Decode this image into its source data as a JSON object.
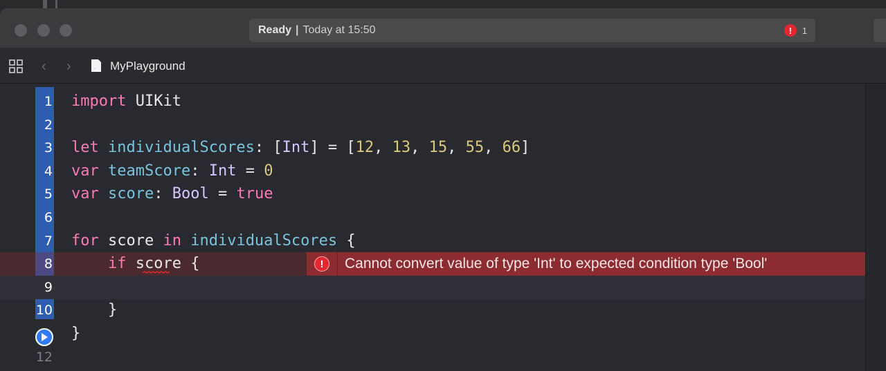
{
  "window": {
    "status_ready": "Ready",
    "status_separator": "|",
    "status_time": "Today at 15:50",
    "error_count": "1",
    "error_badge_glyph": "!"
  },
  "jumpbar": {
    "icons": [
      "grid-icon",
      "back-arrow-icon",
      "forward-arrow-icon",
      "swift-file-icon"
    ],
    "back_glyph": "‹",
    "forward_glyph": "›",
    "file_name": "MyPlayground"
  },
  "editor": {
    "lines": [
      {
        "number": "1",
        "tokens": [
          [
            "kw",
            "import"
          ],
          [
            "plain",
            " UIKit"
          ]
        ]
      },
      {
        "number": "2",
        "tokens": []
      },
      {
        "number": "3",
        "tokens": [
          [
            "kw",
            "let"
          ],
          [
            "plain",
            " "
          ],
          [
            "id",
            "individualScores"
          ],
          [
            "plain",
            ": ["
          ],
          [
            "ty",
            "Int"
          ],
          [
            "plain",
            "] = ["
          ],
          [
            "num",
            "12"
          ],
          [
            "plain",
            ", "
          ],
          [
            "num",
            "13"
          ],
          [
            "plain",
            ", "
          ],
          [
            "num",
            "15"
          ],
          [
            "plain",
            ", "
          ],
          [
            "num",
            "55"
          ],
          [
            "plain",
            ", "
          ],
          [
            "num",
            "66"
          ],
          [
            "plain",
            "]"
          ]
        ]
      },
      {
        "number": "4",
        "tokens": [
          [
            "kw",
            "var"
          ],
          [
            "plain",
            " "
          ],
          [
            "id",
            "teamScore"
          ],
          [
            "plain",
            ": "
          ],
          [
            "ty",
            "Int"
          ],
          [
            "plain",
            " = "
          ],
          [
            "num",
            "0"
          ]
        ]
      },
      {
        "number": "5",
        "tokens": [
          [
            "kw",
            "var"
          ],
          [
            "plain",
            " "
          ],
          [
            "id",
            "score"
          ],
          [
            "plain",
            ": "
          ],
          [
            "ty",
            "Bool"
          ],
          [
            "plain",
            " = "
          ],
          [
            "kw",
            "true"
          ]
        ]
      },
      {
        "number": "6",
        "tokens": []
      },
      {
        "number": "7",
        "tokens": [
          [
            "kw",
            "for"
          ],
          [
            "plain",
            " score "
          ],
          [
            "kw",
            "in"
          ],
          [
            "plain",
            " "
          ],
          [
            "id",
            "individualScores"
          ],
          [
            "plain",
            " {"
          ]
        ]
      },
      {
        "number": "8",
        "tokens": [
          [
            "plain",
            "    "
          ],
          [
            "kw",
            "if"
          ],
          [
            "plain",
            " score {"
          ]
        ]
      },
      {
        "number": "9",
        "tokens": []
      },
      {
        "number": "10",
        "tokens": [
          [
            "plain",
            "    }"
          ]
        ]
      },
      {
        "number": "",
        "tokens": [
          [
            "plain",
            "}"
          ]
        ]
      },
      {
        "number": "12",
        "tokens": []
      }
    ],
    "error_message": "Cannot convert value of type 'Int' to expected condition type 'Bool'",
    "error_glyph": "!",
    "colors": {
      "keyword": "#ff7ab2",
      "type": "#d9c5ff",
      "identifier": "#79c3dc",
      "number": "#d9c97c",
      "gutter_highlight": "#2e5cae",
      "error_banner": "#8c2c30"
    }
  }
}
